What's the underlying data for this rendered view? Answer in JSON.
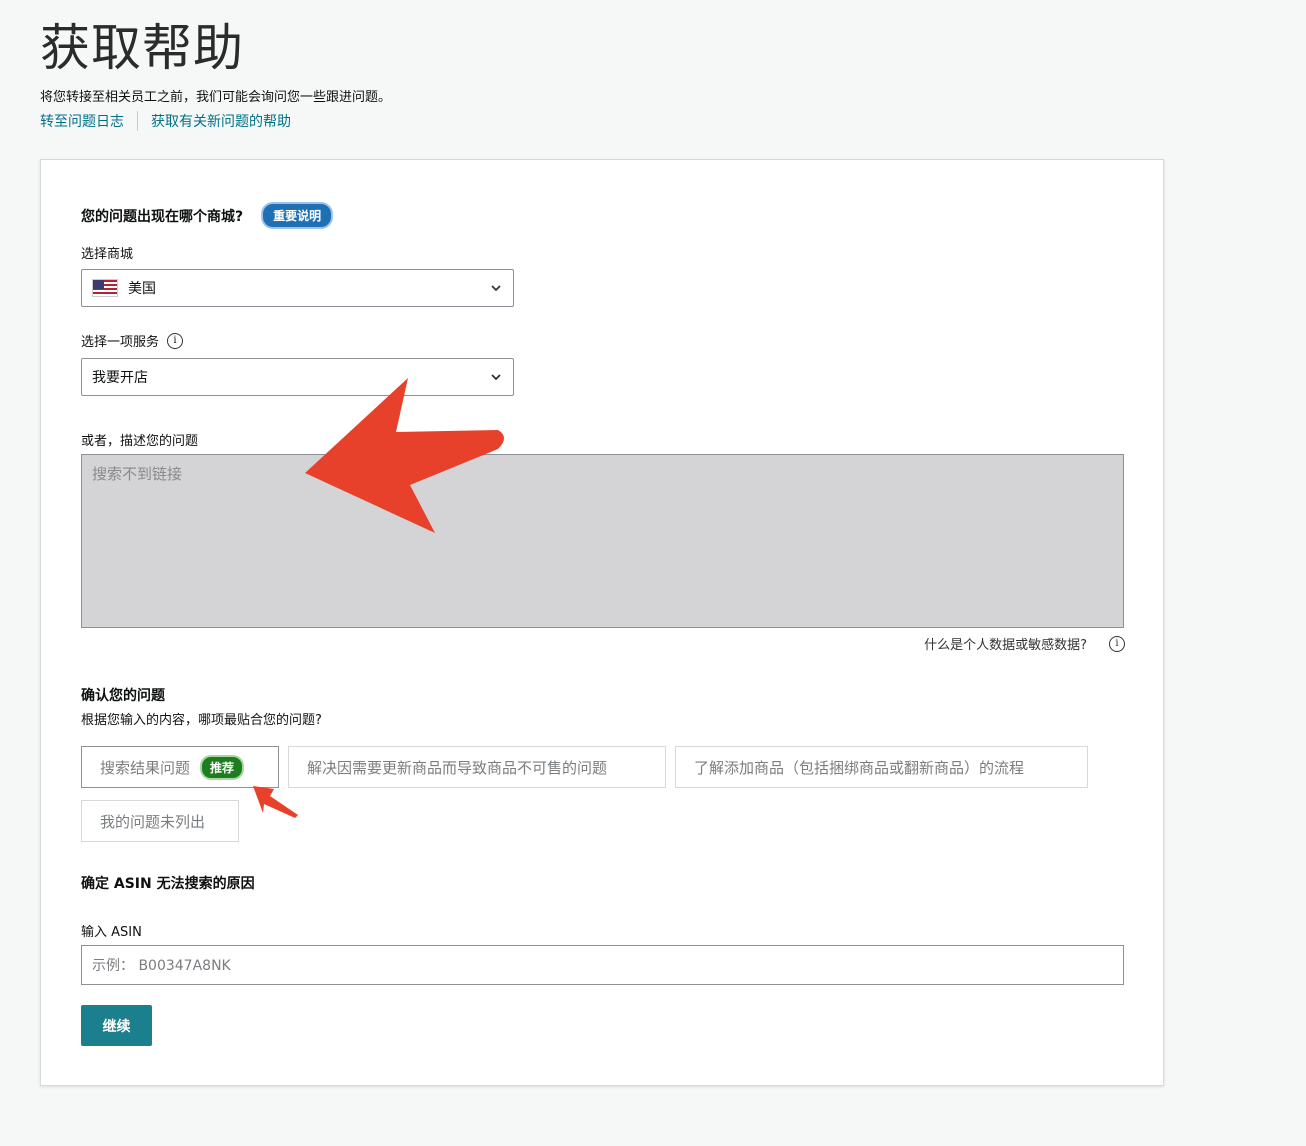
{
  "header": {
    "title": "获取帮助",
    "subtitle": "将您转接至相关员工之前，我们可能会询问您一些跟进问题。",
    "links": [
      "转至问题日志",
      "获取有关新问题的帮助"
    ]
  },
  "form": {
    "marketplace_question": "您的问题出现在哪个商城?",
    "important_note": "重要说明",
    "marketplace_label": "选择商城",
    "marketplace_value": "美国",
    "service_label": "选择一项服务",
    "service_value": "我要开店",
    "describe_label": "或者，描述您的问题",
    "describe_text": "搜索不到链接",
    "privacy_text": "什么是个人数据或敏感数据?",
    "confirm_title": "确认您的问题",
    "confirm_sub": "根据您输入的内容，哪项最贴合您的问题?",
    "options": [
      "搜索结果问题",
      "解决因需要更新商品而导致商品不可售的问题",
      "了解添加商品（包括捆绑商品或翻新商品）的流程",
      "我的问题未列出"
    ],
    "recommended_badge": "推荐",
    "asin_title": "确定 ASIN 无法搜索的原因",
    "asin_label": "输入 ASIN",
    "asin_placeholder": "示例：  B00347A8NK",
    "continue_label": "继续"
  },
  "colors": {
    "link": "#007185",
    "primary_button": "#1b7f8e",
    "annotation_arrow": "#e8412b",
    "recommended_badge": "#1e7d1e"
  }
}
